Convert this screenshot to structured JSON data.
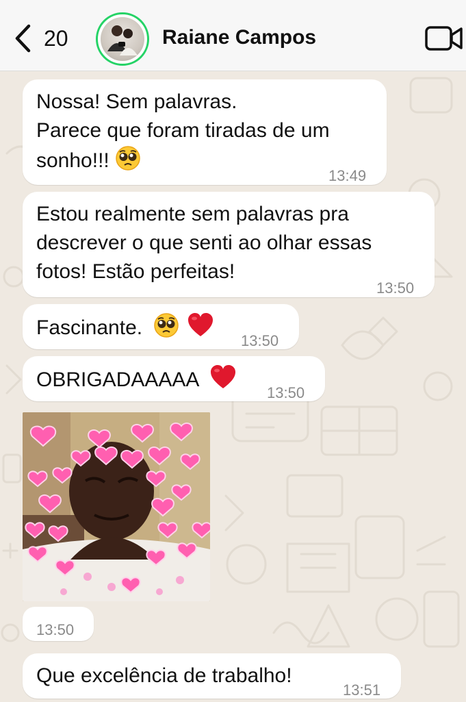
{
  "header": {
    "back_count": "20",
    "contact_name": "Raiane Campos"
  },
  "messages": [
    {
      "text": "Nossa! Sem palavras.\nParece que foram tiradas de um\nsonho!!!",
      "emoji": "🥹",
      "time": "13:49"
    },
    {
      "text": "Estou realmente sem palavras pra\ndescrever o que senti ao olhar essas\nfotos! Estão perfeitas!",
      "time": "13:50"
    },
    {
      "text": "Fascinante.",
      "emoji": "🥹 ❤️",
      "time": "13:50"
    },
    {
      "text": "OBRIGADAAAAA",
      "emoji": "❤️",
      "time": "13:50"
    },
    {
      "type": "sticker",
      "icon": "crying-man-hearts-sticker",
      "time": "13:50"
    },
    {
      "text": "Que excelência de trabalho!",
      "time": "13:51"
    }
  ],
  "colors": {
    "accent": "#25d366",
    "bubble": "#ffffff",
    "background": "#efeae2",
    "timestamp": "#8a8a8a",
    "heart": "#e0182d"
  }
}
